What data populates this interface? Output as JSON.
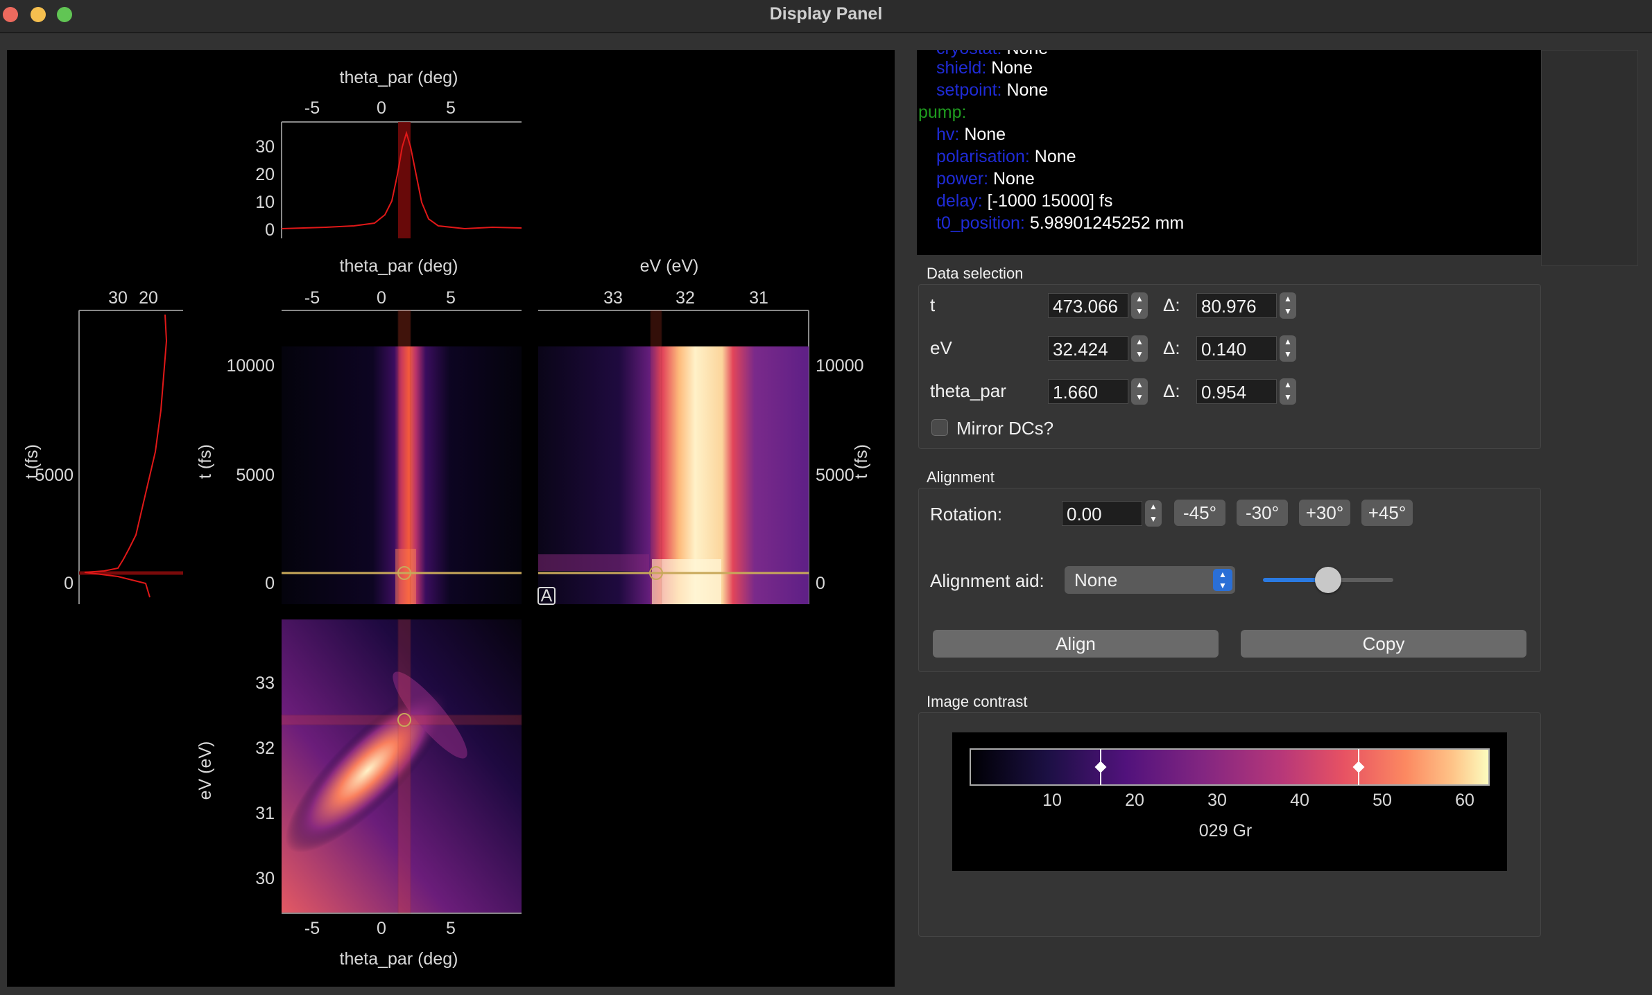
{
  "window": {
    "title": "Display Panel"
  },
  "plots": {
    "top_profile": {
      "x_label": "theta_par (deg)",
      "x_ticks": [
        "-5",
        "0",
        "5"
      ],
      "y_ticks": [
        "30",
        "20",
        "10",
        "0"
      ]
    },
    "left_profile": {
      "x_ticks": [
        "30",
        "20"
      ],
      "y_label": "t (fs)",
      "y_ticks": [
        "5000",
        "0"
      ]
    },
    "t_theta": {
      "x_label": "theta_par (deg)",
      "x_ticks": [
        "-5",
        "0",
        "5"
      ],
      "y_label": "t (fs)",
      "y_ticks": [
        "10000",
        "5000",
        "0"
      ]
    },
    "t_ev": {
      "x_label": "eV (eV)",
      "x_ticks": [
        "33",
        "32",
        "31"
      ],
      "y_label": "t (fs)",
      "y_ticks": [
        "10000",
        "5000",
        "0"
      ],
      "badge": "A"
    },
    "ev_theta": {
      "x_label": "theta_par (deg)",
      "x_ticks": [
        "-5",
        "0",
        "5"
      ],
      "y_label": "eV (eV)",
      "y_ticks": [
        "33",
        "32",
        "31",
        "30"
      ]
    }
  },
  "metadata": {
    "lines": [
      {
        "key": "cryostat:",
        "value": "None",
        "indent": true
      },
      {
        "key": "shield:",
        "value": "None",
        "indent": true
      },
      {
        "key": "setpoint:",
        "value": "None",
        "indent": true
      },
      {
        "group": "pump:"
      },
      {
        "key": "hv:",
        "value": "None",
        "indent": true
      },
      {
        "key": "polarisation:",
        "value": "None",
        "indent": true
      },
      {
        "key": "power:",
        "value": "None",
        "indent": true
      },
      {
        "key": "delay:",
        "value": "[-1000 15000] fs",
        "indent": true
      },
      {
        "key": "t0_position:",
        "value": "5.98901245252 mm",
        "indent": true
      }
    ]
  },
  "data_selection": {
    "title": "Data selection",
    "delta_symbol": "Δ:",
    "rows": [
      {
        "label": "t",
        "value": "473.066",
        "delta": "80.976"
      },
      {
        "label": "eV",
        "value": "32.424",
        "delta": "0.140"
      },
      {
        "label": "theta_par",
        "value": "1.660",
        "delta": "0.954"
      }
    ],
    "mirror_label": "Mirror DCs?",
    "mirror_checked": false
  },
  "alignment": {
    "title": "Alignment",
    "rotation_label": "Rotation:",
    "rotation_value": "0.00",
    "rotation_buttons": [
      "-45°",
      "-30°",
      "+30°",
      "+45°"
    ],
    "aid_label": "Alignment aid:",
    "aid_value": "None",
    "slider_level": 0.5,
    "align_button": "Align",
    "copy_button": "Copy"
  },
  "image_contrast": {
    "title": "Image contrast",
    "colorbar_ticks": [
      "10",
      "20",
      "30",
      "40",
      "50",
      "60"
    ],
    "colorbar_label": "029 Gr",
    "handle_low": 16,
    "handle_high": 47
  }
}
